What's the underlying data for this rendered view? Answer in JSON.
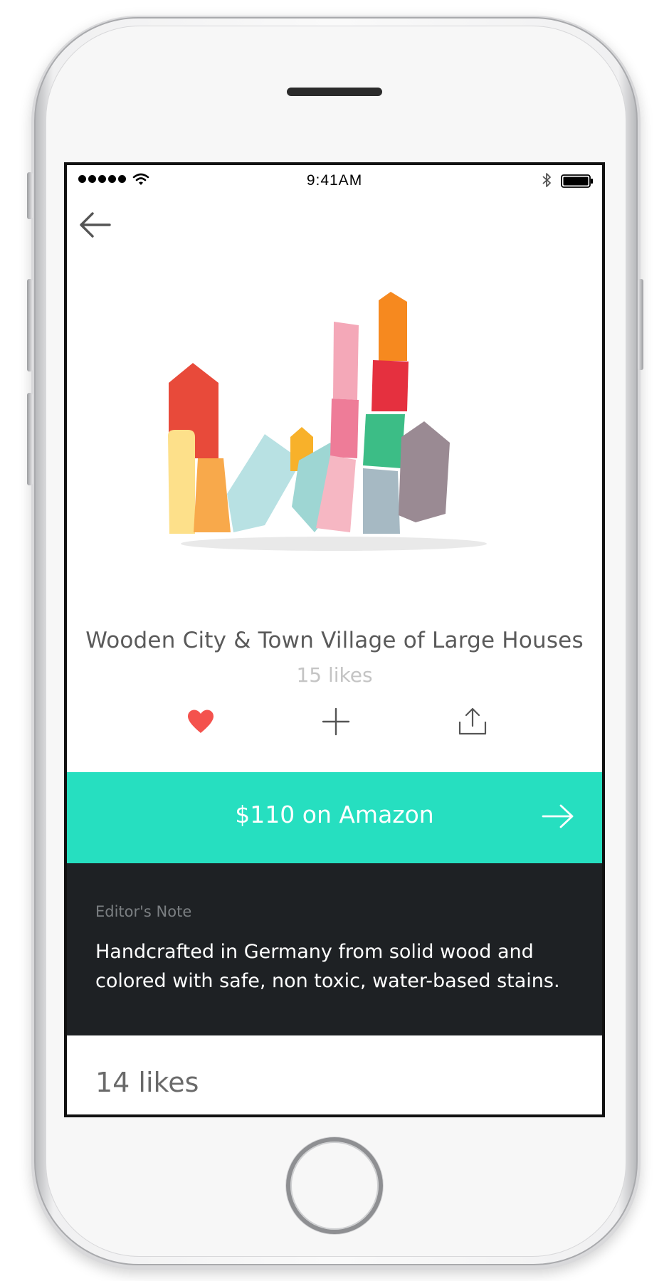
{
  "status_bar": {
    "time": "9:41AM",
    "signal_icon": "signal-dots-icon",
    "wifi_icon": "wifi-icon",
    "bluetooth_icon": "bluetooth-icon",
    "battery_icon": "battery-icon"
  },
  "nav": {
    "back_icon": "back-arrow-icon"
  },
  "product": {
    "image_icon": "wooden-blocks-image",
    "title": "Wooden City & Town Village of Large Houses",
    "likes": "15 likes"
  },
  "actions": {
    "like_icon": "heart-icon",
    "add_icon": "plus-icon",
    "share_icon": "share-icon"
  },
  "buy": {
    "label": "$110 on Amazon",
    "arrow_icon": "arrow-right-icon"
  },
  "editor_note": {
    "label": "Editor's Note",
    "text": "Handcrafted in Germany from solid wood and colored with safe, non toxic, water-based stains."
  },
  "likes_section": {
    "count": "14 likes"
  },
  "colors": {
    "accent": "#26dfc0",
    "heart": "#f4524d",
    "note_background": "#1e2124"
  }
}
